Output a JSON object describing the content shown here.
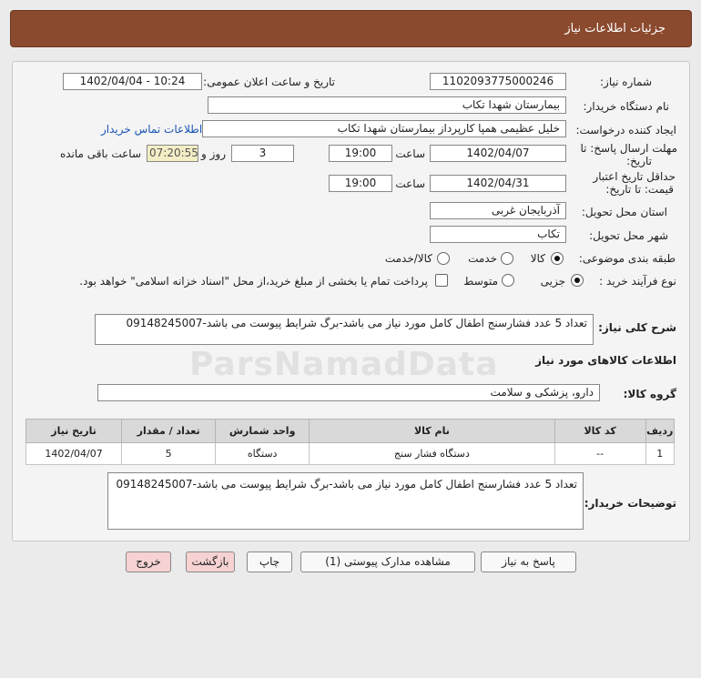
{
  "header": {
    "title": "جزئیات اطلاعات نیاز"
  },
  "form": {
    "need_number_label": "شماره نیاز:",
    "need_number": "1102093775000246",
    "announce_label": "تاریخ و ساعت اعلان عمومی:",
    "announce_value": "1402/04/04 - 10:24",
    "buyer_org_label": "نام دستگاه خریدار:",
    "buyer_org": "بیمارستان شهدا تکاب",
    "creator_label": "ایجاد کننده درخواست:",
    "creator": "خلیل عظیمی همپا کارپرداز بیمارستان شهدا تکاب",
    "contact_link": "اطلاعات تماس خریدار",
    "deadline_label_1": "مهلت ارسال پاسخ: تا",
    "deadline_label_2": "تاریخ:",
    "deadline_date": "1402/04/07",
    "time_label": "ساعت",
    "deadline_time": "19:00",
    "days_value": "3",
    "days_label": "روز و",
    "remaining_time": "07:20:55",
    "remaining_label": "ساعت باقی مانده",
    "validity_label_1": "حداقل تاریخ اعتبار",
    "validity_label_2": "قیمت: تا تاریخ:",
    "validity_date": "1402/04/31",
    "validity_time": "19:00",
    "province_label": "استان محل تحویل:",
    "province": "آذربایجان غربی",
    "city_label": "شهر محل تحویل:",
    "city": "تکاب",
    "category_label": "طبقه بندی موضوعی:",
    "category_options": [
      "کالا",
      "خدمت",
      "کالا/خدمت"
    ],
    "purchase_type_label": "نوع فرآیند خرید :",
    "purchase_options": [
      "جزیی",
      "متوسط"
    ],
    "treasury_note": "پرداخت تمام یا بخشی از مبلغ خرید،از محل \"اسناد خزانه اسلامی\" خواهد بود."
  },
  "description": {
    "label": "شرح کلی نیاز:",
    "text": "تعداد 5 عدد فشارسنج اطفال کامل مورد نیاز می باشد-برگ شرایط پیوست می باشد-09148245007"
  },
  "goods": {
    "section_title": "اطلاعات کالاهای مورد نیاز",
    "group_label": "گروه کالا:",
    "group_value": "دارو، پزشکی و سلامت",
    "table": {
      "headers": [
        "ردیف",
        "کد کالا",
        "نام کالا",
        "واحد شمارش",
        "تعداد / مقدار",
        "تاریخ نیاز"
      ],
      "rows": [
        [
          "1",
          "--",
          "دستگاه فشار سنج",
          "دستگاه",
          "5",
          "1402/04/07"
        ]
      ]
    }
  },
  "buyer_notes": {
    "label": "توضیحات خریدار:",
    "text": "تعداد 5 عدد فشارسنج اطفال کامل مورد نیاز می باشد-برگ شرایط پیوست می باشد-09148245007"
  },
  "buttons": {
    "reply": "پاسخ به نیاز",
    "attachments": "مشاهده مدارک پیوستی (1)",
    "print": "چاپ",
    "back": "بازگشت",
    "exit": "خروج"
  },
  "watermark": {
    "brand": "ParsNamadData"
  }
}
